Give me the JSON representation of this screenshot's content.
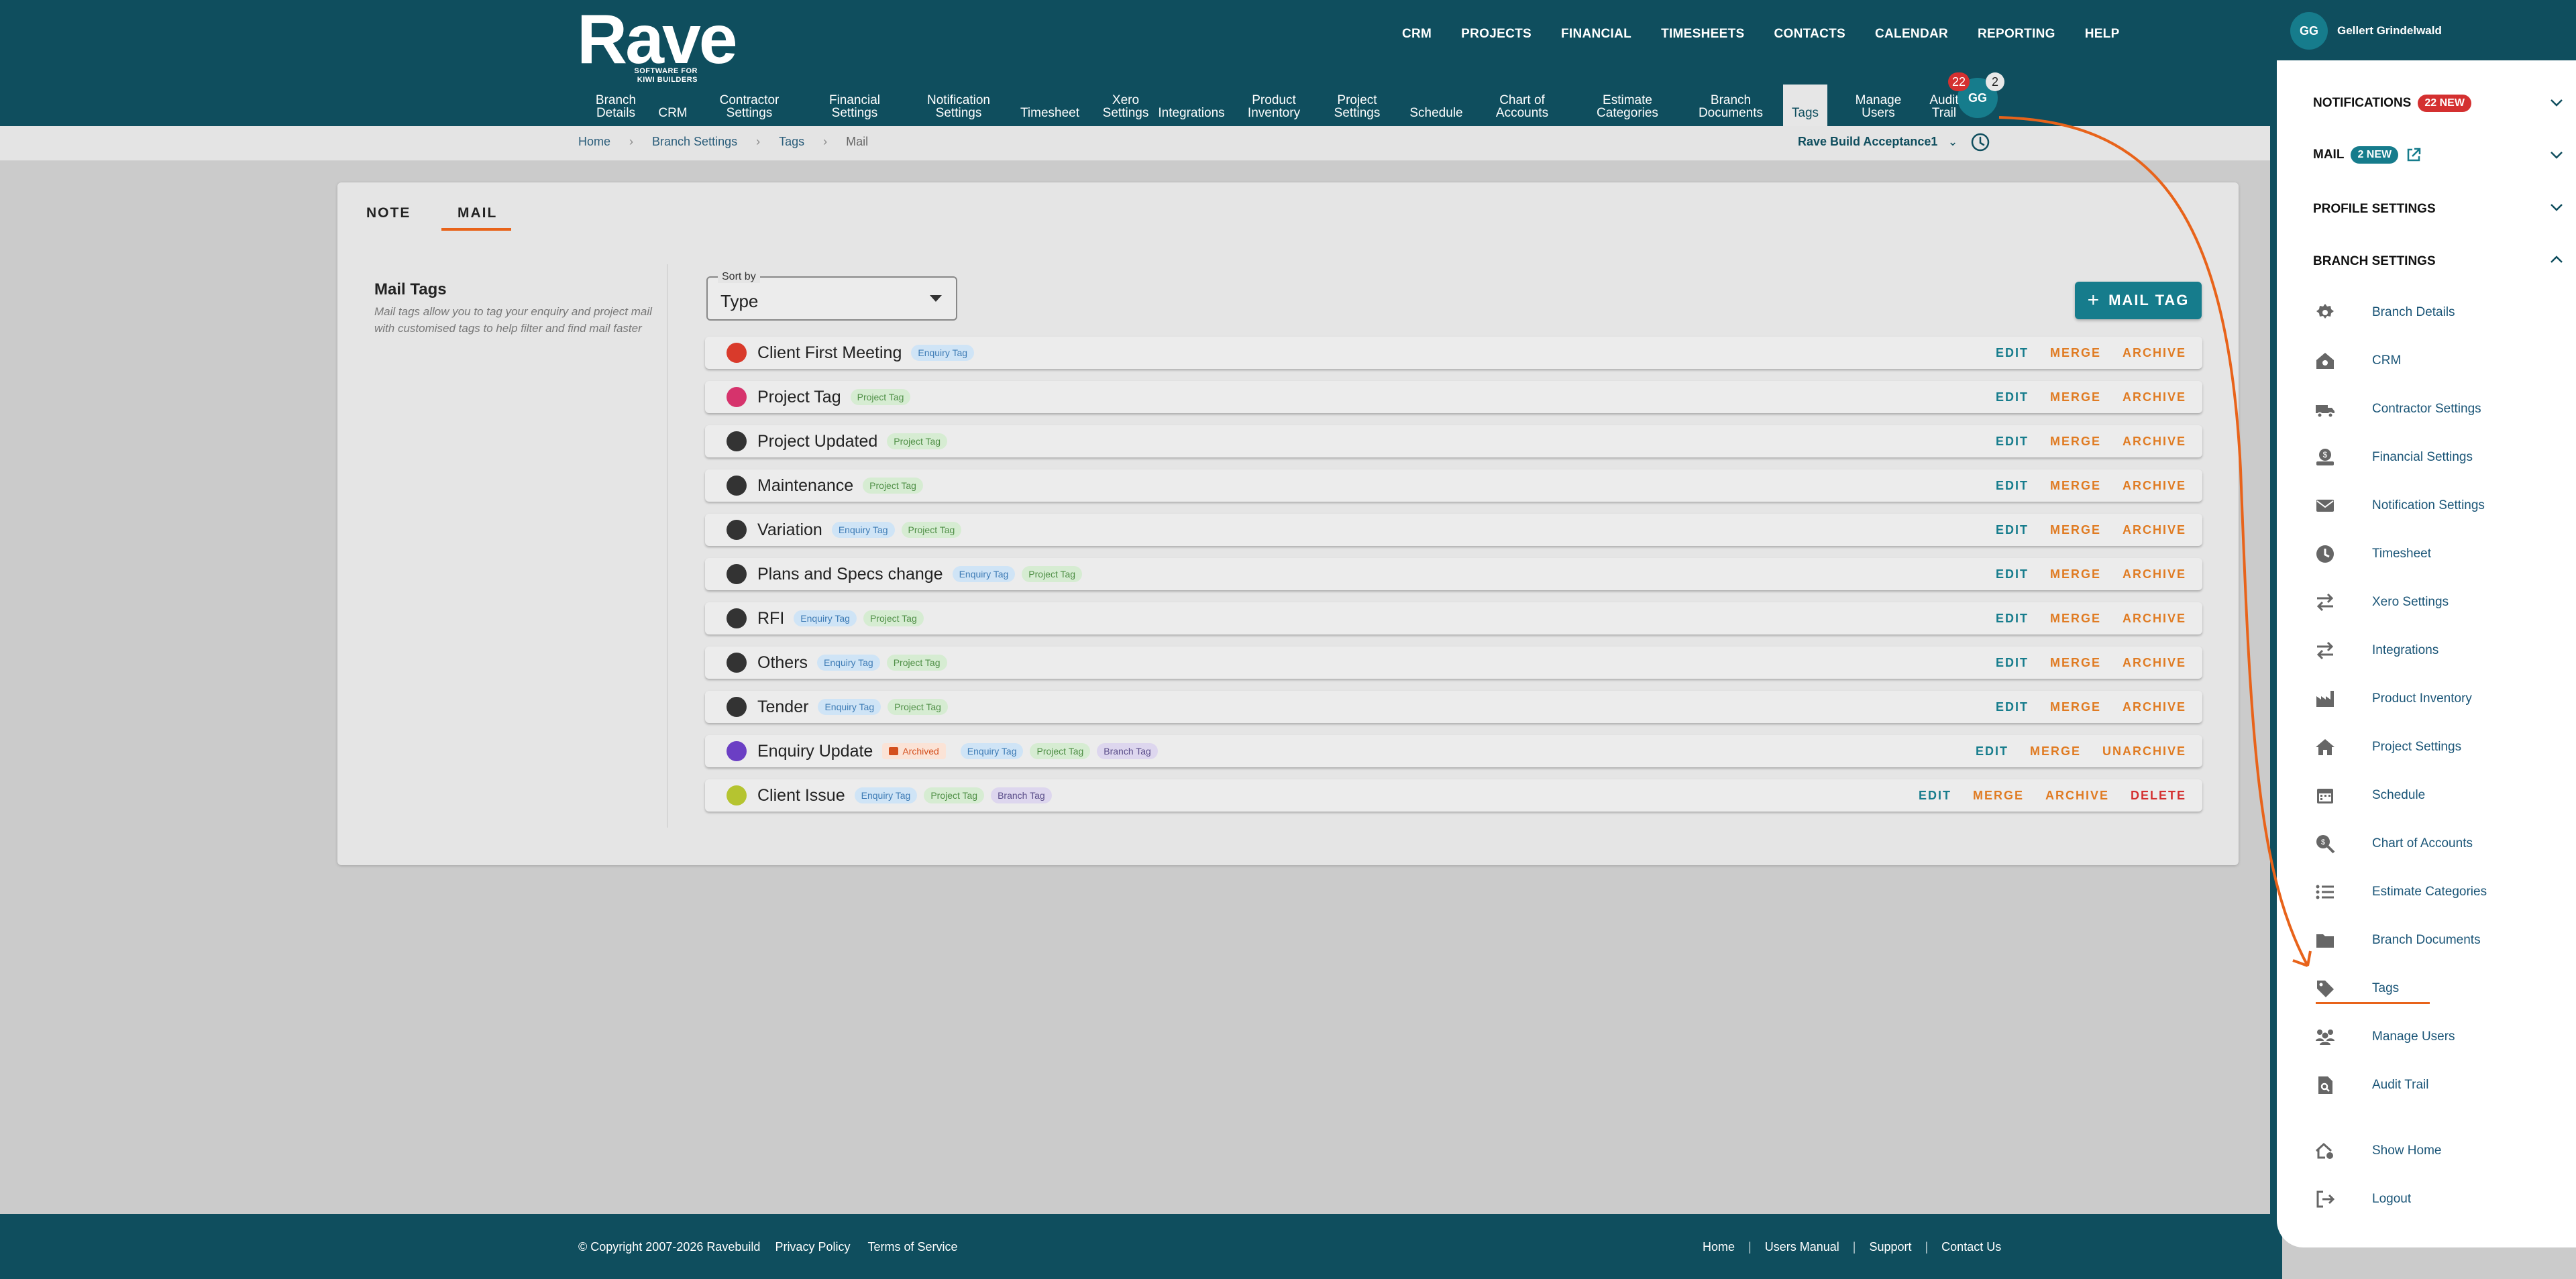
{
  "logo": {
    "main": "Rave",
    "sub1": "SOFTWARE FOR",
    "sub2": "KIWI BUILDERS"
  },
  "topnav": [
    "CRM",
    "PROJECTS",
    "FINANCIAL",
    "TIMESHEETS",
    "CONTACTS",
    "CALENDAR",
    "REPORTING",
    "HELP"
  ],
  "subnav": [
    "Branch\nDetails",
    "CRM",
    "Contractor\nSettings",
    "Financial\nSettings",
    "Notification\nSettings",
    "Timesheet",
    "Xero\nSettings",
    "Integrations",
    "Product\nInventory",
    "Project\nSettings",
    "Schedule",
    "Chart of\nAccounts",
    "Estimate\nCategories",
    "Branch\nDocuments",
    "Tags",
    "Manage\nUsers",
    "Audit\nTrail"
  ],
  "badges": {
    "notifications": "22",
    "mail": "2"
  },
  "avatar_initials": "GG",
  "breadcrumb": [
    "Home",
    "Branch Settings",
    "Tags",
    "Mail"
  ],
  "branch_selector": "Rave Build Acceptance1",
  "tabs": [
    "NOTE",
    "MAIL"
  ],
  "sidebar": {
    "title": "Mail Tags",
    "description": "Mail tags allow you to tag your enquiry and project mail with customised tags to help filter and find mail faster"
  },
  "sort": {
    "label": "Sort by",
    "value": "Type"
  },
  "add_button": "MAIL TAG",
  "rows": [
    {
      "name": "Client First Meeting",
      "color": "#d93a2b",
      "tags": [
        "Enquiry Tag"
      ],
      "actions": [
        "EDIT",
        "MERGE",
        "ARCHIVE"
      ]
    },
    {
      "name": "Project Tag",
      "color": "#d6336c",
      "tags": [
        "Project Tag"
      ],
      "actions": [
        "EDIT",
        "MERGE",
        "ARCHIVE"
      ]
    },
    {
      "name": "Project Updated",
      "color": "#333333",
      "tags": [
        "Project Tag"
      ],
      "actions": [
        "EDIT",
        "MERGE",
        "ARCHIVE"
      ]
    },
    {
      "name": "Maintenance",
      "color": "#333333",
      "tags": [
        "Project Tag"
      ],
      "actions": [
        "EDIT",
        "MERGE",
        "ARCHIVE"
      ]
    },
    {
      "name": "Variation",
      "color": "#333333",
      "tags": [
        "Enquiry Tag",
        "Project Tag"
      ],
      "actions": [
        "EDIT",
        "MERGE",
        "ARCHIVE"
      ]
    },
    {
      "name": "Plans and Specs change",
      "color": "#333333",
      "tags": [
        "Enquiry Tag",
        "Project Tag"
      ],
      "actions": [
        "EDIT",
        "MERGE",
        "ARCHIVE"
      ]
    },
    {
      "name": "RFI",
      "color": "#333333",
      "tags": [
        "Enquiry Tag",
        "Project Tag"
      ],
      "actions": [
        "EDIT",
        "MERGE",
        "ARCHIVE"
      ]
    },
    {
      "name": "Others",
      "color": "#333333",
      "tags": [
        "Enquiry Tag",
        "Project Tag"
      ],
      "actions": [
        "EDIT",
        "MERGE",
        "ARCHIVE"
      ]
    },
    {
      "name": "Tender",
      "color": "#333333",
      "tags": [
        "Enquiry Tag",
        "Project Tag"
      ],
      "actions": [
        "EDIT",
        "MERGE",
        "ARCHIVE"
      ]
    },
    {
      "name": "Enquiry Update",
      "color": "#6b3fc4",
      "archived": "Archived",
      "tags": [
        "Enquiry Tag",
        "Project Tag",
        "Branch Tag"
      ],
      "actions": [
        "EDIT",
        "MERGE",
        "UNARCHIVE"
      ]
    },
    {
      "name": "Client Issue",
      "color": "#b5c430",
      "tags": [
        "Enquiry Tag",
        "Project Tag",
        "Branch Tag"
      ],
      "actions": [
        "EDIT",
        "MERGE",
        "ARCHIVE",
        "DELETE"
      ]
    }
  ],
  "footer": {
    "copyright": "© Copyright 2007-2026 Ravebuild",
    "privacy": "Privacy Policy",
    "terms": "Terms of Service",
    "links": [
      "Home",
      "Users Manual",
      "Support",
      "Contact Us"
    ]
  },
  "panel": {
    "user_name": "Gellert Grindelwald",
    "initials": "GG",
    "notifications_label": "NOTIFICATIONS",
    "notifications_badge": "22 NEW",
    "mail_label": "MAIL",
    "mail_badge": "2 NEW",
    "profile_label": "PROFILE SETTINGS",
    "branch_label": "BRANCH SETTINGS",
    "menu": [
      {
        "label": "Branch Details",
        "icon": "gear-icon"
      },
      {
        "label": "CRM",
        "icon": "house-gear-icon"
      },
      {
        "label": "Contractor Settings",
        "icon": "truck-icon"
      },
      {
        "label": "Financial Settings",
        "icon": "money-icon"
      },
      {
        "label": "Notification Settings",
        "icon": "envelope-icon"
      },
      {
        "label": "Timesheet",
        "icon": "clock-icon"
      },
      {
        "label": "Xero Settings",
        "icon": "swap-icon"
      },
      {
        "label": "Integrations",
        "icon": "swap-icon"
      },
      {
        "label": "Product Inventory",
        "icon": "factory-icon"
      },
      {
        "label": "Project Settings",
        "icon": "home-icon"
      },
      {
        "label": "Schedule",
        "icon": "calendar-icon"
      },
      {
        "label": "Chart of Accounts",
        "icon": "search-money-icon"
      },
      {
        "label": "Estimate Categories",
        "icon": "list-icon"
      },
      {
        "label": "Branch Documents",
        "icon": "folder-icon"
      },
      {
        "label": "Tags",
        "icon": "tag-icon"
      },
      {
        "label": "Manage Users",
        "icon": "users-icon"
      },
      {
        "label": "Audit Trail",
        "icon": "file-search-icon"
      }
    ],
    "show_home": "Show Home",
    "logout": "Logout"
  },
  "colors": {
    "brand": "#0f4e5e",
    "accent": "#167c8c",
    "orange": "#e07b22",
    "red": "#d43030"
  }
}
